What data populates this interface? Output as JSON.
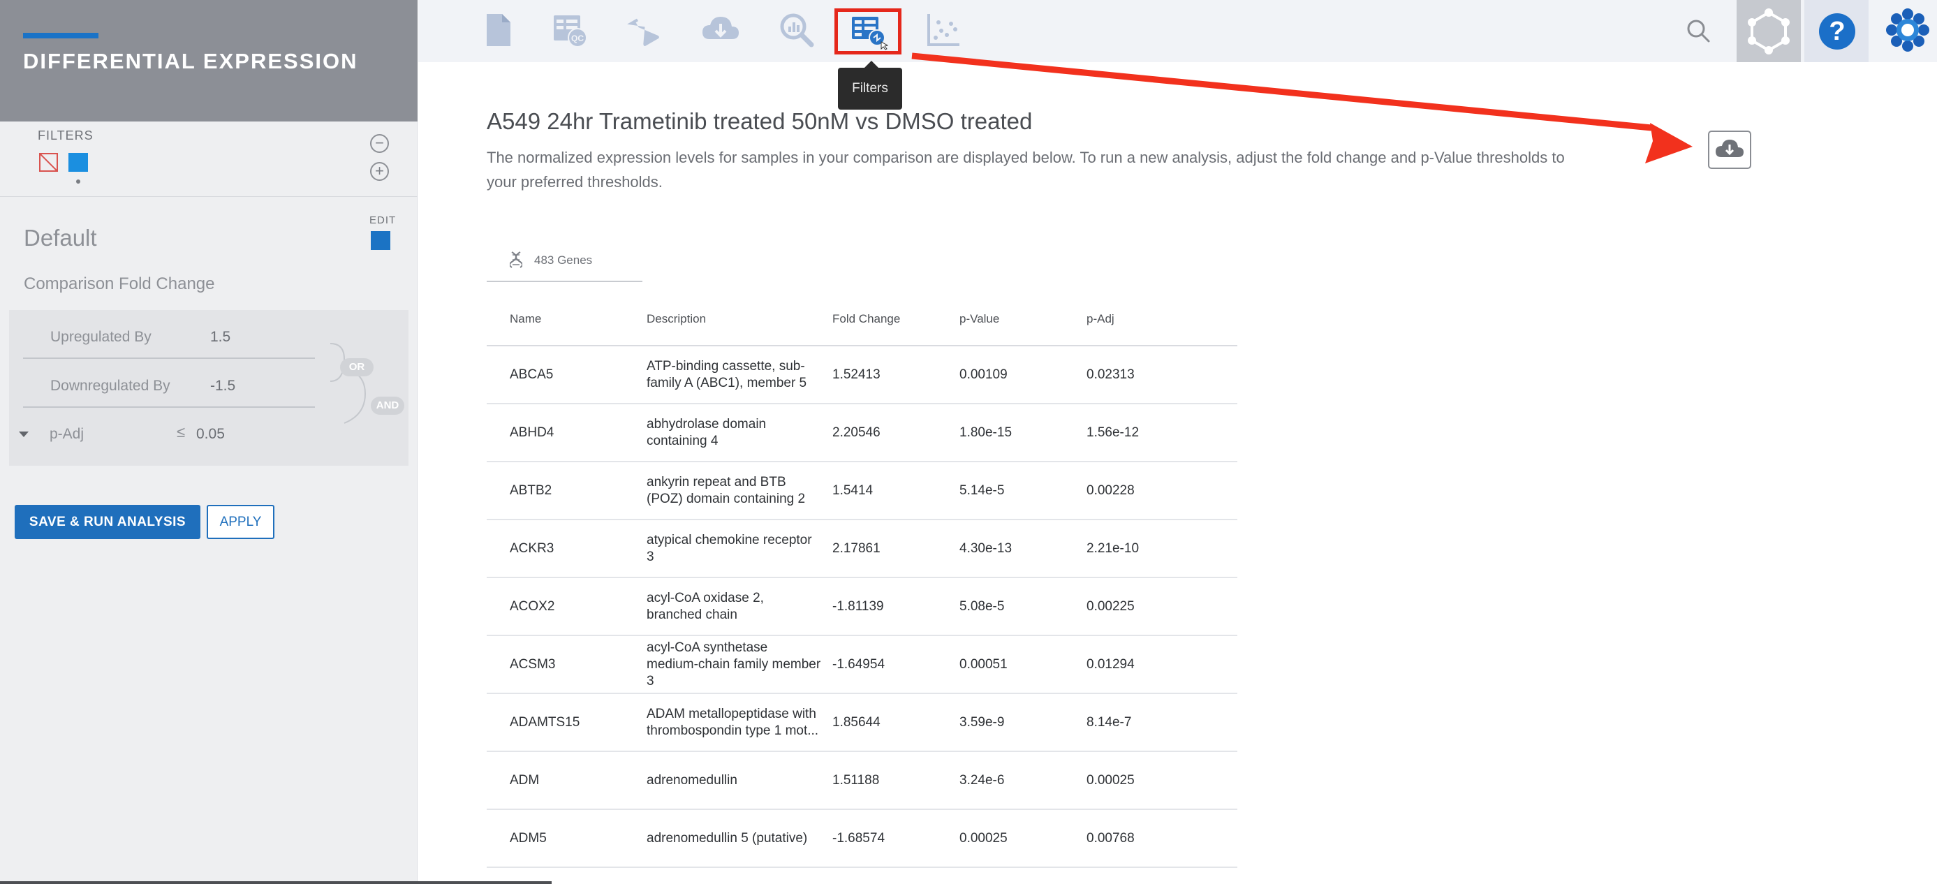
{
  "sidebar": {
    "title": "DIFFERENTIAL EXPRESSION",
    "filters_label": "FILTERS",
    "minus": "−",
    "plus": "+",
    "filter_name": "Default",
    "edit_label": "EDIT",
    "section_label": "Comparison Fold Change",
    "upregulated_label": "Upregulated By",
    "upregulated_value": "1.5",
    "downregulated_label": "Downregulated By",
    "downregulated_value": "-1.5",
    "or_label": "OR",
    "and_label": "AND",
    "padj_label": "p-Adj",
    "padj_operator": "≤",
    "padj_value": "0.05",
    "save_run_label": "SAVE & RUN ANALYSIS",
    "apply_label": "APPLY"
  },
  "toolbar": {
    "icons": [
      "document-icon",
      "qc-table-icon",
      "flask-icon",
      "cloud-download-icon",
      "analysis-search-icon",
      "filters-table-icon",
      "scatter-plot-icon"
    ],
    "active_icon": "filters-table-icon",
    "tooltip": "Filters",
    "help_glyph": "?"
  },
  "main": {
    "title": "A549 24hr Trametinib treated 50nM vs DMSO treated",
    "description": "The normalized expression levels for samples in your comparison are displayed below. To run a new analysis, adjust the fold change and p-Value thresholds to your preferred thresholds.",
    "genes_tab": "483 Genes",
    "columns": [
      "Name",
      "Description",
      "Fold Change",
      "p-Value",
      "p-Adj"
    ],
    "rows": [
      {
        "name": "ABCA5",
        "description": "ATP-binding cassette, sub-family A (ABC1), member 5",
        "fold_change": "1.52413",
        "p_value": "0.00109",
        "p_adj": "0.02313"
      },
      {
        "name": "ABHD4",
        "description": "abhydrolase domain containing 4",
        "fold_change": "2.20546",
        "p_value": "1.80e-15",
        "p_adj": "1.56e-12"
      },
      {
        "name": "ABTB2",
        "description": "ankyrin repeat and BTB (POZ) domain containing 2",
        "fold_change": "1.5414",
        "p_value": "5.14e-5",
        "p_adj": "0.00228"
      },
      {
        "name": "ACKR3",
        "description": "atypical chemokine receptor 3",
        "fold_change": "2.17861",
        "p_value": "4.30e-13",
        "p_adj": "2.21e-10"
      },
      {
        "name": "ACOX2",
        "description": "acyl-CoA oxidase 2, branched chain",
        "fold_change": "-1.81139",
        "p_value": "5.08e-5",
        "p_adj": "0.00225"
      },
      {
        "name": "ACSM3",
        "description": "acyl-CoA synthetase medium-chain family member 3",
        "fold_change": "-1.64954",
        "p_value": "0.00051",
        "p_adj": "0.01294"
      },
      {
        "name": "ADAMTS15",
        "description": "ADAM metallopeptidase with thrombospondin type 1 mot...",
        "fold_change": "1.85644",
        "p_value": "3.59e-9",
        "p_adj": "8.14e-7"
      },
      {
        "name": "ADM",
        "description": "adrenomedullin",
        "fold_change": "1.51188",
        "p_value": "3.24e-6",
        "p_adj": "0.00025"
      },
      {
        "name": "ADM5",
        "description": "adrenomedullin 5 (putative)",
        "fold_change": "-1.68574",
        "p_value": "0.00025",
        "p_adj": "0.00768"
      }
    ]
  },
  "colors": {
    "accent": "#1f6fbc",
    "highlight": "#e5271b",
    "sidebar_header": "#8c8f96"
  }
}
